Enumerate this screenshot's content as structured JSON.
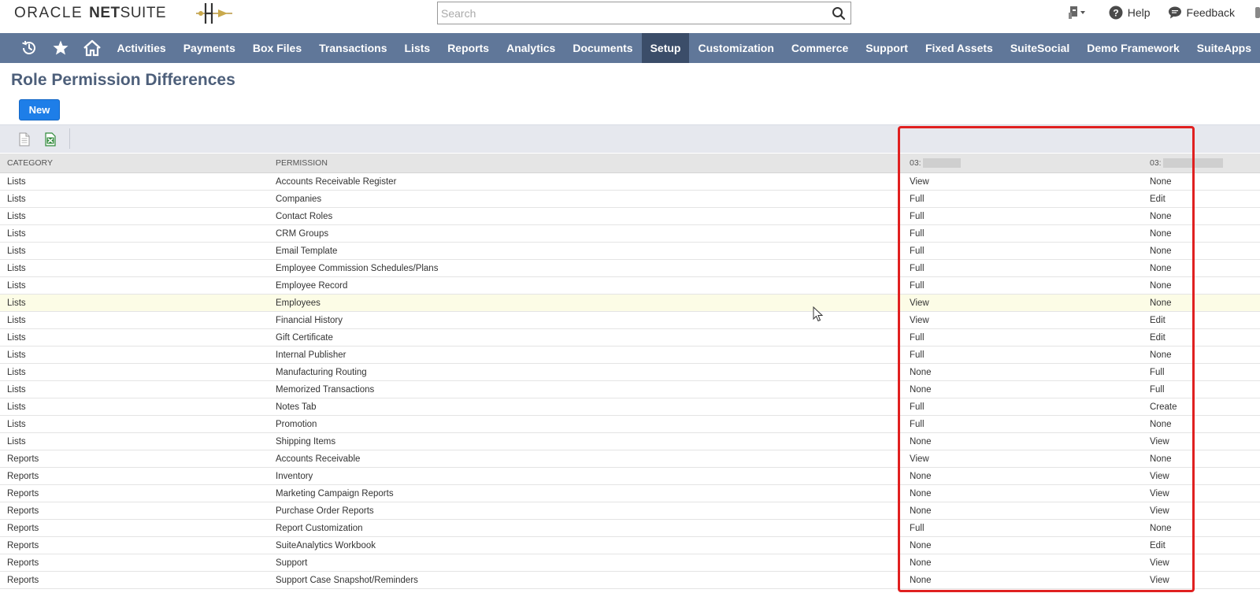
{
  "header": {
    "logo_oracle": "ORACLE",
    "logo_net": "NET",
    "logo_suite": "SUITE",
    "search_placeholder": "Search",
    "help_label": "Help",
    "feedback_label": "Feedback"
  },
  "nav": {
    "items": [
      {
        "label": "Activities"
      },
      {
        "label": "Payments"
      },
      {
        "label": "Box Files"
      },
      {
        "label": "Transactions"
      },
      {
        "label": "Lists"
      },
      {
        "label": "Reports"
      },
      {
        "label": "Analytics"
      },
      {
        "label": "Documents"
      },
      {
        "label": "Setup",
        "active": true
      },
      {
        "label": "Customization"
      },
      {
        "label": "Commerce"
      },
      {
        "label": "Support"
      },
      {
        "label": "Fixed Assets"
      },
      {
        "label": "SuiteSocial"
      },
      {
        "label": "Demo Framework"
      },
      {
        "label": "SuiteApps"
      }
    ]
  },
  "page": {
    "title": "Role Permission Differences",
    "new_button": "New"
  },
  "table": {
    "headers": [
      "CATEGORY",
      "PERMISSION",
      "03:",
      "03:"
    ],
    "rows": [
      [
        "Lists",
        "Accounts Receivable Register",
        "View",
        "None"
      ],
      [
        "Lists",
        "Companies",
        "Full",
        "Edit"
      ],
      [
        "Lists",
        "Contact Roles",
        "Full",
        "None"
      ],
      [
        "Lists",
        "CRM Groups",
        "Full",
        "None"
      ],
      [
        "Lists",
        "Email Template",
        "Full",
        "None"
      ],
      [
        "Lists",
        "Employee Commission Schedules/Plans",
        "Full",
        "None"
      ],
      [
        "Lists",
        "Employee Record",
        "Full",
        "None"
      ],
      [
        "Lists",
        "Employees",
        "View",
        "None"
      ],
      [
        "Lists",
        "Financial History",
        "View",
        "Edit"
      ],
      [
        "Lists",
        "Gift Certificate",
        "Full",
        "Edit"
      ],
      [
        "Lists",
        "Internal Publisher",
        "Full",
        "None"
      ],
      [
        "Lists",
        "Manufacturing Routing",
        "None",
        "Full"
      ],
      [
        "Lists",
        "Memorized Transactions",
        "None",
        "Full"
      ],
      [
        "Lists",
        "Notes Tab",
        "Full",
        "Create"
      ],
      [
        "Lists",
        "Promotion",
        "Full",
        "None"
      ],
      [
        "Lists",
        "Shipping Items",
        "None",
        "View"
      ],
      [
        "Reports",
        "Accounts Receivable",
        "View",
        "None"
      ],
      [
        "Reports",
        "Inventory",
        "None",
        "View"
      ],
      [
        "Reports",
        "Marketing Campaign Reports",
        "None",
        "View"
      ],
      [
        "Reports",
        "Purchase Order Reports",
        "None",
        "View"
      ],
      [
        "Reports",
        "Report Customization",
        "Full",
        "None"
      ],
      [
        "Reports",
        "SuiteAnalytics Workbook",
        "None",
        "Edit"
      ],
      [
        "Reports",
        "Support",
        "None",
        "View"
      ],
      [
        "Reports",
        "Support Case Snapshot/Reminders",
        "None",
        "View"
      ]
    ]
  },
  "colors": {
    "nav_bg": "#607799",
    "nav_active": "#3b4d69",
    "title": "#4d5f7a",
    "button": "#1e7ee8",
    "highlight": "#e02020"
  }
}
